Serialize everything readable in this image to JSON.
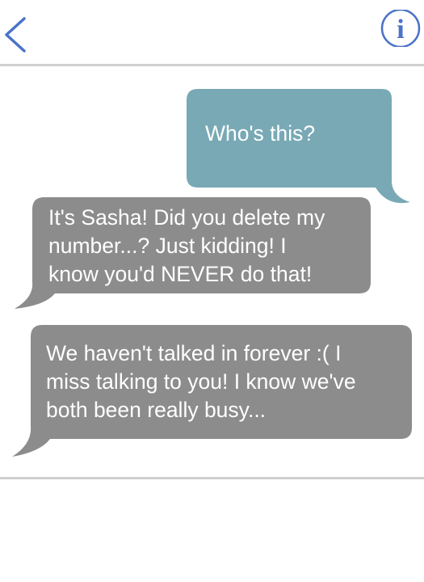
{
  "header": {
    "back_icon": "chevron-left-icon",
    "info_icon": "info-circle-icon",
    "info_glyph": "i",
    "accent_color": "#4a72c8"
  },
  "messages": [
    {
      "direction": "outgoing",
      "text": "Who's this?",
      "color": "#78a9b5"
    },
    {
      "direction": "incoming",
      "text": "It's Sasha! Did you delete my\nnumber...? Just kidding! I\nknow you'd NEVER do that!",
      "color": "#8c8c8c"
    },
    {
      "direction": "incoming",
      "text": "We haven't talked in forever :( I\nmiss talking to you! I know we've\nboth been really busy...",
      "color": "#8c8c8c"
    }
  ]
}
